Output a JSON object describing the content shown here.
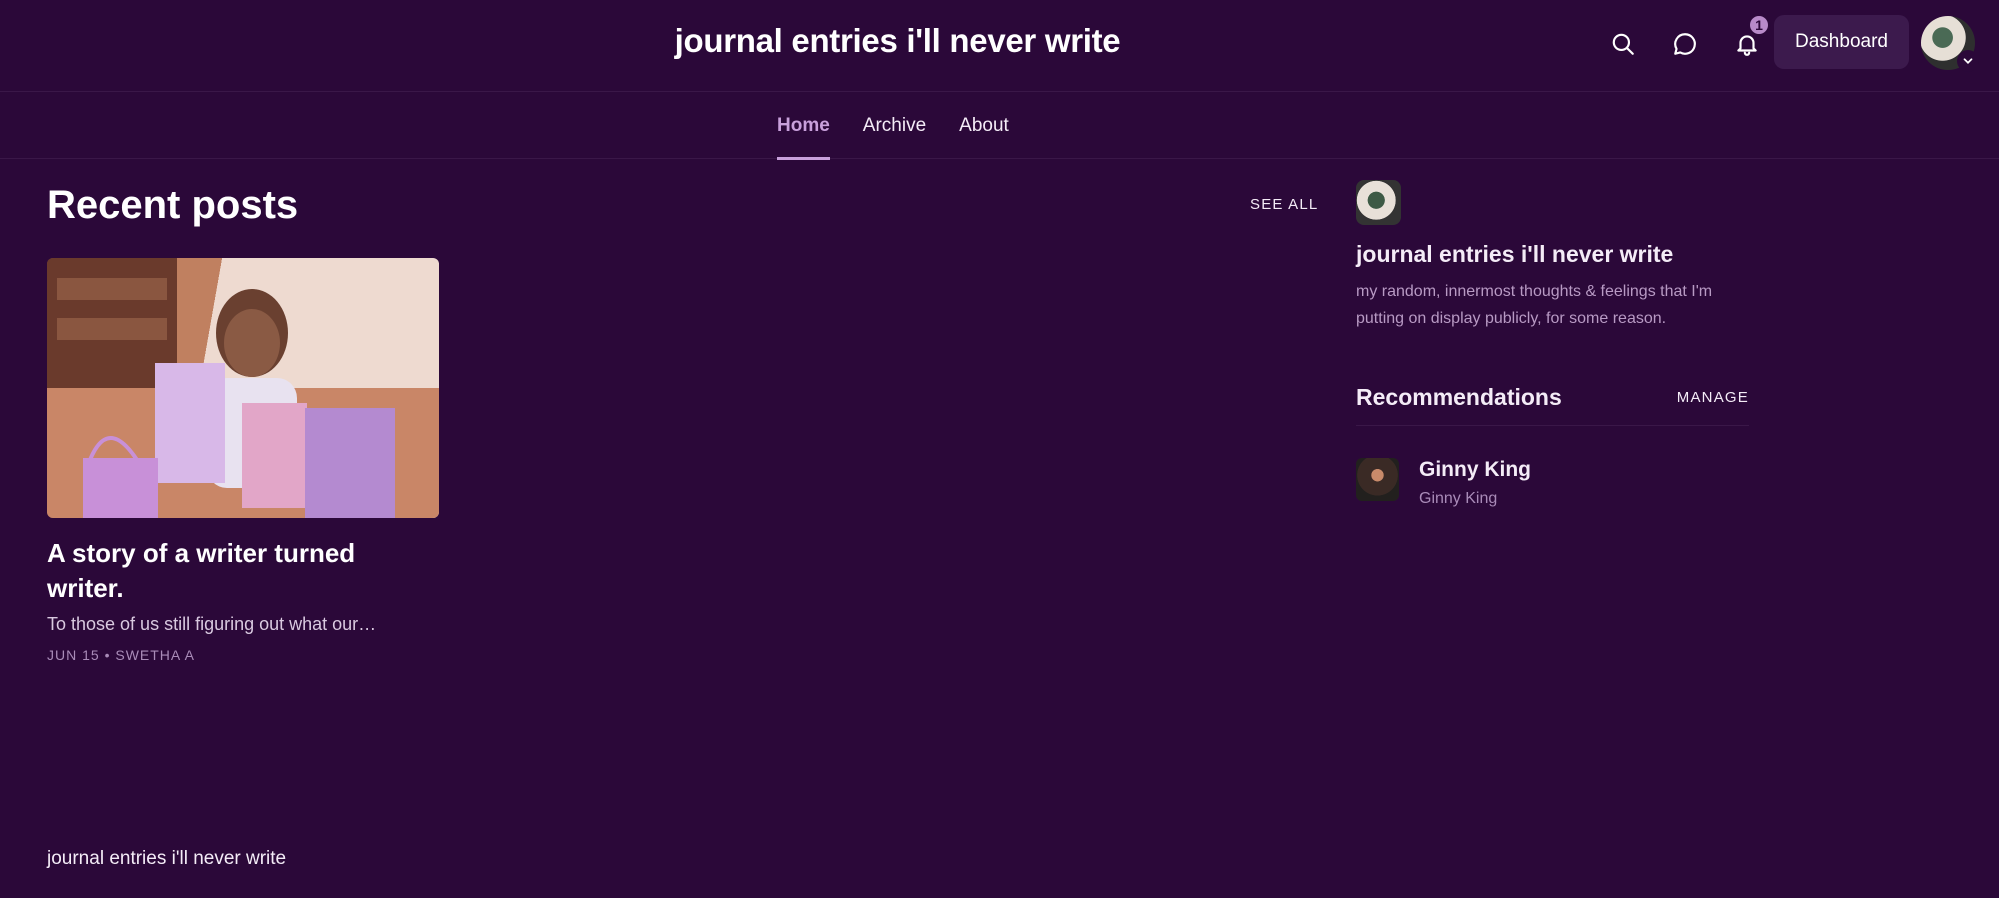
{
  "header": {
    "title": "journal entries i'll never write",
    "notification_count": "1",
    "dashboard_label": "Dashboard"
  },
  "nav": {
    "tabs": [
      {
        "label": "Home",
        "active": true
      },
      {
        "label": "Archive",
        "active": false
      },
      {
        "label": "About",
        "active": false
      }
    ]
  },
  "main": {
    "section_title": "Recent posts",
    "see_all_label": "SEE ALL",
    "posts": [
      {
        "title": "A story of a writer turned writer.",
        "excerpt": "To those of us still figuring out what our…",
        "date": "JUN 15",
        "author": "SWETHA A",
        "meta": "JUN 15 • SWETHA A"
      }
    ]
  },
  "sidebar": {
    "publication_name": "journal entries i'll never write",
    "publication_description": "my random, innermost thoughts & feelings that I'm putting on display publicly, for some reason.",
    "recommendations_title": "Recommendations",
    "manage_label": "MANAGE",
    "recommendations": [
      {
        "name": "Ginny King",
        "subtitle": "Ginny King"
      }
    ]
  },
  "footer": {
    "text": "journal entries i'll never write"
  },
  "colors": {
    "background": "#2b0839",
    "accent": "#c9a0dc",
    "muted": "#a98bb8"
  },
  "icons": [
    "search-icon",
    "chat-icon",
    "bell-icon",
    "chevron-down-icon"
  ]
}
